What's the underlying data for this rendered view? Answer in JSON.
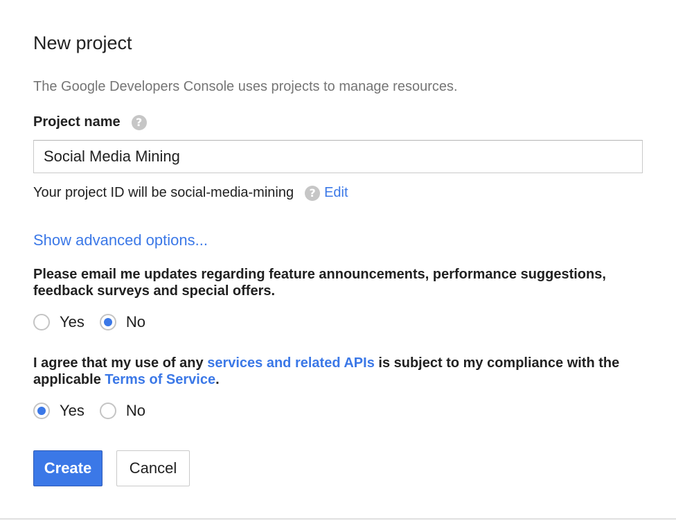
{
  "dialog": {
    "title": "New project",
    "description": "The Google Developers Console uses projects to manage resources.",
    "project_name_label": "Project name",
    "help_glyph": "?",
    "project_name_value": "Social Media Mining",
    "project_id_text": "Your project ID will be social-media-mining",
    "edit_link": "Edit",
    "advanced_link": "Show advanced options...",
    "email_question": "Please email me updates regarding feature announcements, performance suggestions, feedback surveys and special offers.",
    "email_options": {
      "yes": "Yes",
      "no": "No",
      "selected": "No"
    },
    "terms_question": {
      "part1": "I agree that my use of any ",
      "link1": "services and related APIs",
      "part2": " is subject to my compliance with the applicable ",
      "link2": "Terms of Service",
      "part3": "."
    },
    "terms_options": {
      "yes": "Yes",
      "no": "No",
      "selected": "Yes"
    },
    "create_button": "Create",
    "cancel_button": "Cancel"
  },
  "colors": {
    "accent": "#3b78e7",
    "muted_text": "#757575",
    "help_icon": "#c6c6c6"
  }
}
